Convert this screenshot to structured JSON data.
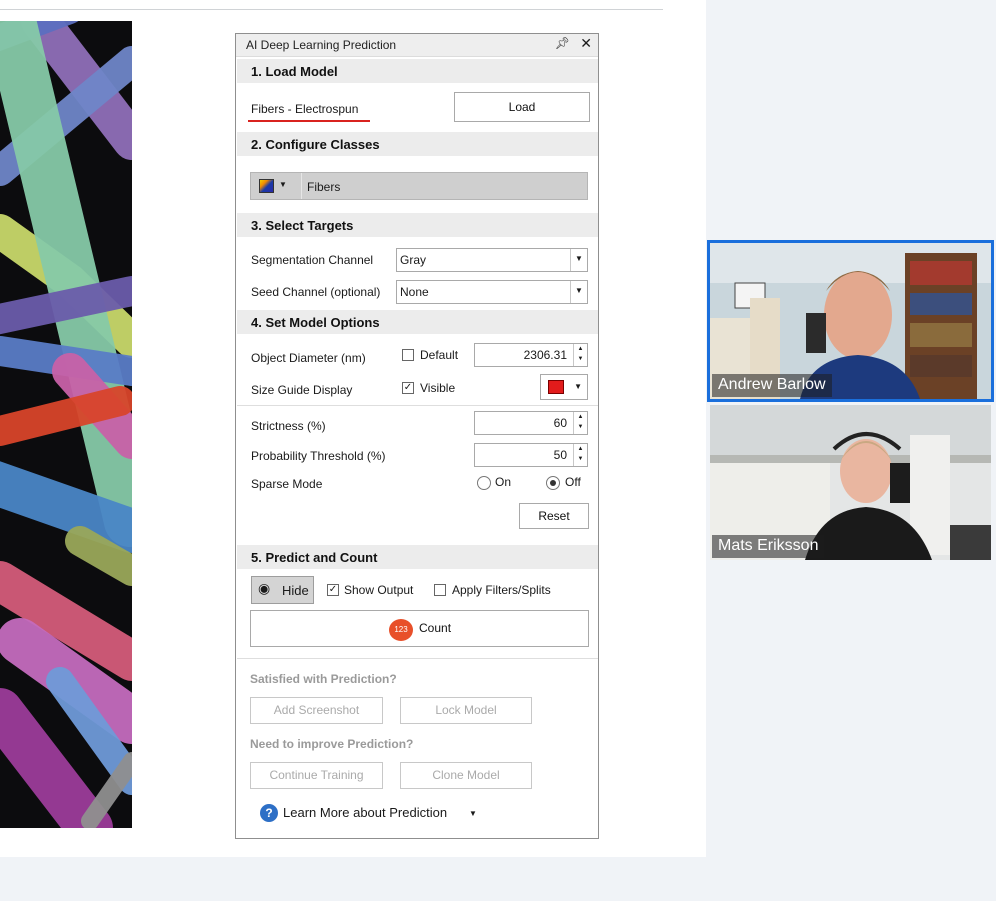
{
  "panel": {
    "title": "AI Deep Learning Prediction",
    "pin_icon": "pin-icon",
    "close_icon": "close-icon",
    "s1": {
      "heading": "1. Load Model",
      "model_name": "Fibers - Electrospun",
      "load_label": "Load"
    },
    "s2": {
      "heading": "2. Configure Classes",
      "class_name": "Fibers"
    },
    "s3": {
      "heading": "3. Select Targets",
      "seg_label": "Segmentation Channel",
      "seg_value": "Gray",
      "seed_label": "Seed Channel (optional)",
      "seed_value": "None"
    },
    "s4": {
      "heading": "4. Set Model Options",
      "diameter_label": "Object Diameter (nm)",
      "default_label": "Default",
      "diameter_value": "2306.31",
      "guide_label": "Size Guide Display",
      "visible_label": "Visible",
      "guide_color": "#e21b1b",
      "strictness_label": "Strictness (%)",
      "strictness_value": "60",
      "prob_label": "Probability Threshold (%)",
      "prob_value": "50",
      "sparse_label": "Sparse Mode",
      "on_label": "On",
      "off_label": "Off",
      "reset_label": "Reset"
    },
    "s5": {
      "heading": "5. Predict and Count",
      "hide_label": "Hide",
      "show_output_label": "Show Output",
      "apply_filters_label": "Apply Filters/Splits",
      "count_badge": "123",
      "count_label": "Count"
    },
    "footer": {
      "satisfied": "Satisfied with Prediction?",
      "add_screenshot": "Add Screenshot",
      "lock_model": "Lock Model",
      "improve": "Need to improve Prediction?",
      "continue_training": "Continue Training",
      "clone_model": "Clone Model",
      "learn_more": "Learn More about Prediction"
    }
  },
  "participants": [
    {
      "name": "Andrew Barlow",
      "active": true
    },
    {
      "name": "Mats Eriksson",
      "active": false
    }
  ],
  "colors": {
    "accent": "#1a6fdc",
    "model_underline": "#d9231f",
    "count_badge": "#e8502a"
  }
}
